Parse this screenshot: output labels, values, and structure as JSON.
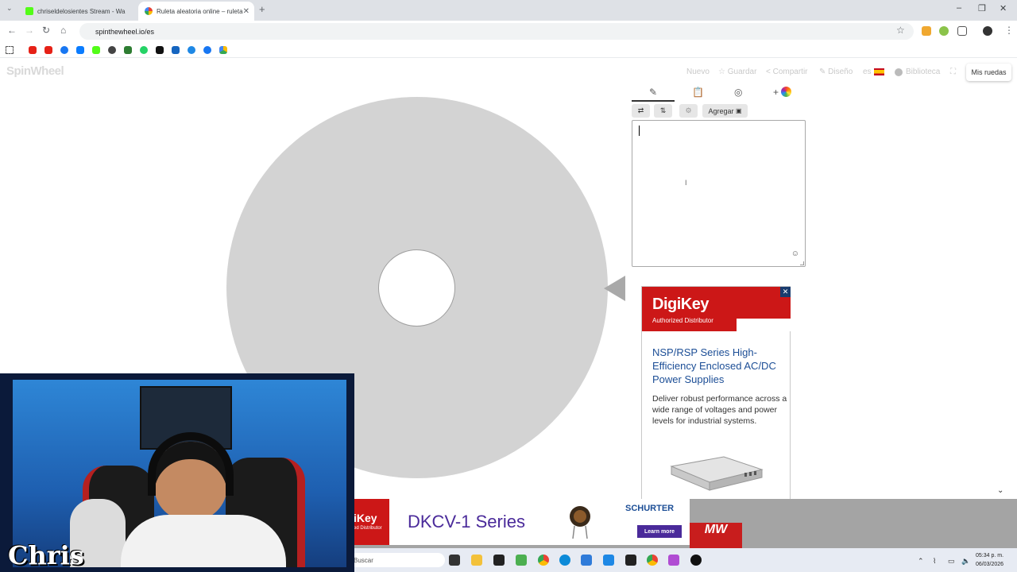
{
  "browser": {
    "tabs": [
      {
        "title": "chriseldelosientes Stream - Wa",
        "favicon_color": "#53fc18",
        "active": false
      },
      {
        "title": "Ruleta aleatoria online – ruleta",
        "favicon_color": "#e94235",
        "active": true
      }
    ],
    "new_tab": "+",
    "url": "spinthewheel.io/es",
    "window_controls": [
      "–",
      "❐",
      "✕"
    ]
  },
  "page": {
    "logo": "SpinWheel",
    "nav": {
      "new": "Nuevo",
      "save": "☆ Guardar",
      "share": "< Compartir",
      "design": "✎ Diseño",
      "lang": "es",
      "library": "Biblioteca"
    },
    "my_wheels": "Mis ruedas",
    "add_label": "Agregar",
    "plus": "+",
    "entries_value": ""
  },
  "ad": {
    "brand": "DigiKey",
    "subtitle": "Authorized Distributor",
    "close": "✕",
    "headline": "NSP/RSP Series High-Efficiency Enclosed AC/DC Power Supplies",
    "body": "Deliver robust performance across a wide range of voltages and power levels for industrial systems."
  },
  "banner": {
    "brand_short": "iKey",
    "brand_sub": "ed Distributor",
    "title": "DKCV-1 Series",
    "partner": "SCHURTER",
    "cta": "Learn more",
    "mw_logo": "MW"
  },
  "taskbar": {
    "search_placeholder": "Buscar",
    "time": "05:34 p. m.",
    "date": "06/03/2026"
  },
  "webcam": {
    "overlay_name": "Chris"
  }
}
